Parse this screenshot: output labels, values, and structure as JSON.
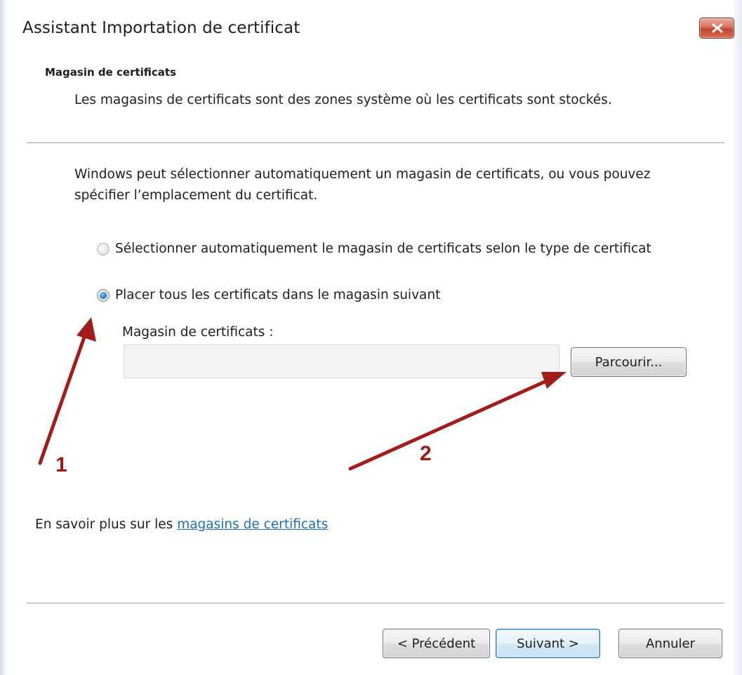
{
  "window": {
    "title": "Assistant Importation de certificat"
  },
  "header": {
    "title": "Magasin de certificats",
    "description": "Les magasins de certificats sont des zones système où les certificats sont stockés."
  },
  "body": {
    "intro": "Windows peut sélectionner automatiquement un magasin de certificats, ou vous pouvez spécifier l’emplacement du certificat.",
    "options": [
      {
        "label": "Sélectionner automatiquement le magasin de certificats selon le type de certificat",
        "selected": false
      },
      {
        "label": "Placer tous les certificats dans le magasin suivant",
        "selected": true
      }
    ],
    "store_label": "Magasin de certificats :",
    "store_value": "",
    "browse_label": "Parcourir..."
  },
  "footer": {
    "learn_more_prefix": "En savoir plus sur les ",
    "learn_more_link": "magasins de certificats",
    "back_label": "< Précédent",
    "next_label": "Suivant >",
    "cancel_label": "Annuler"
  },
  "annotations": {
    "arrow1_number": "1",
    "arrow2_number": "2",
    "arrow_color": "#a31c1c"
  },
  "icons": {
    "close": "close-icon"
  }
}
